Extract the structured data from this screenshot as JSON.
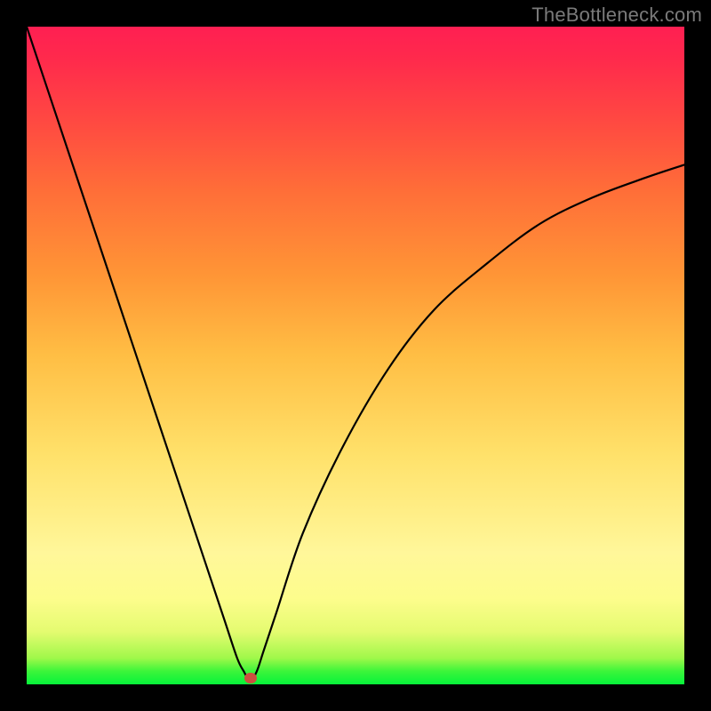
{
  "watermark": "TheBottleneck.com",
  "chart_data": {
    "type": "line",
    "title": "",
    "xlabel": "",
    "ylabel": "",
    "xlim": [
      0,
      100
    ],
    "ylim": [
      0,
      100
    ],
    "grid": false,
    "legend": false,
    "marker": {
      "x": 34,
      "y": 1
    },
    "series": [
      {
        "name": "curve",
        "x": [
          0,
          4,
          8,
          12,
          16,
          20,
          24,
          28,
          30,
          32,
          33,
          34,
          35,
          36,
          38,
          42,
          48,
          55,
          62,
          70,
          78,
          86,
          94,
          100
        ],
        "values": [
          100,
          88,
          76,
          64,
          52,
          40,
          28,
          16,
          10,
          4,
          2,
          0.5,
          2,
          5,
          11,
          23,
          36,
          48,
          57,
          64,
          70,
          74,
          77,
          79
        ]
      }
    ],
    "colors": {
      "curve_stroke": "#000000",
      "marker_fill": "#cc4f3f",
      "gradient_top": "#ff1f52",
      "gradient_bottom": "#06f33a"
    }
  }
}
